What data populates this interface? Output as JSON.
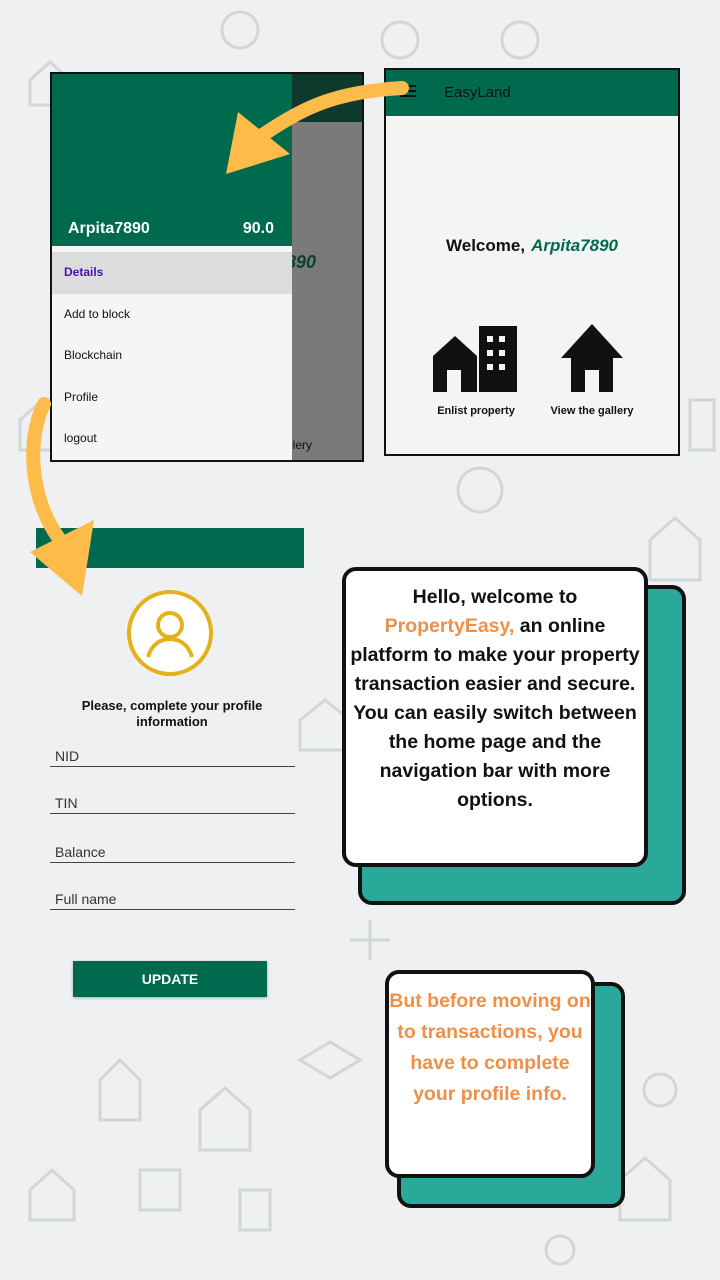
{
  "drawer": {
    "username": "Arpita7890",
    "balance": "90.0",
    "menu": [
      "Details",
      "Add to block",
      "Blockchain",
      "Profile",
      "logout"
    ],
    "behind_name_fragment": "890",
    "behind_gallery_fragment": "llery"
  },
  "home": {
    "app_title": "EasyLand",
    "welcome": "Welcome,",
    "username": "Arpita7890",
    "enlist_label": "Enlist property",
    "gallery_label": "View the gallery"
  },
  "profile": {
    "prompt": "Please, complete your profile information",
    "fields": [
      "NID",
      "TIN",
      "Balance",
      "Full name"
    ],
    "update_label": "UPDATE"
  },
  "callout1": {
    "line_a": "Hello, welcome to",
    "brand": "PropertyEasy,",
    "line_b": "an online platform to make your property transaction easier and secure. You can easily switch between the home page and the navigation bar with more options."
  },
  "callout2": {
    "text": "But before moving on to transactions, you have to complete your profile info."
  },
  "colors": {
    "primary_green": "#006a4e",
    "accent_orange": "#f08f47",
    "teal": "#2aa89a",
    "arrow_yellow": "#fdbb4a",
    "avatar_gold": "#e3b118"
  }
}
